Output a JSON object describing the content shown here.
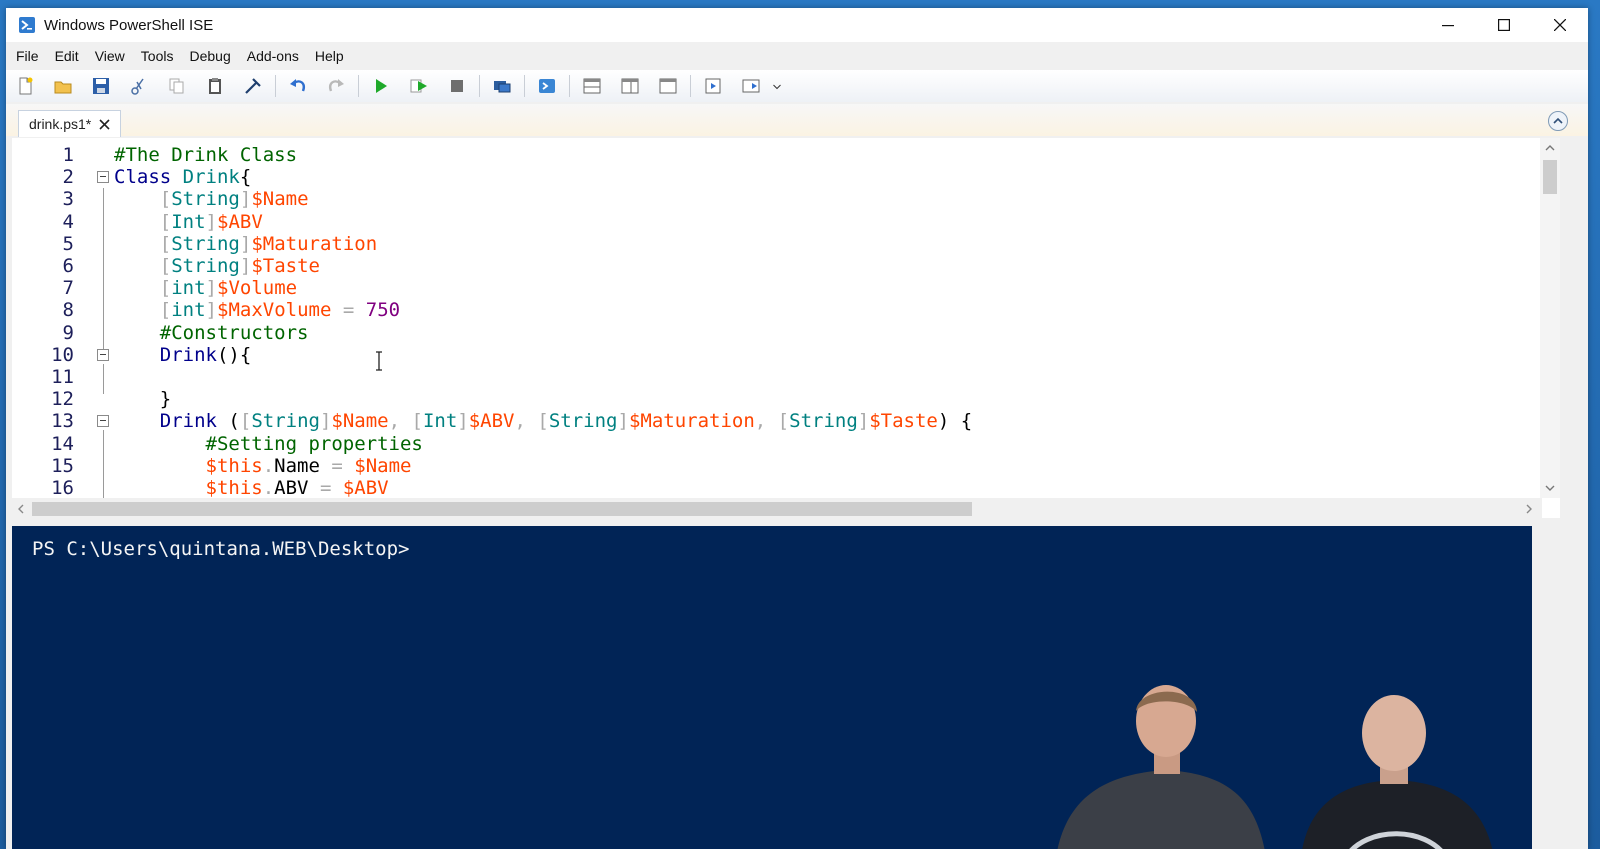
{
  "window": {
    "title": "Windows PowerShell ISE"
  },
  "menu": [
    "File",
    "Edit",
    "View",
    "Tools",
    "Debug",
    "Add-ons",
    "Help"
  ],
  "tab": {
    "label": "drink.ps1*"
  },
  "editor": {
    "lines": [
      {
        "n": "1",
        "fold": false,
        "tokens": [
          [
            "c",
            "#The Drink Class"
          ]
        ]
      },
      {
        "n": "2",
        "fold": true,
        "tokens": [
          [
            "k",
            "Class"
          ],
          [
            "d",
            " "
          ],
          [
            "t",
            "Drink"
          ],
          [
            "d",
            "{"
          ]
        ]
      },
      {
        "n": "3",
        "fold": false,
        "tokens": [
          [
            "d",
            "    "
          ],
          [
            "o",
            "["
          ],
          [
            "t",
            "String"
          ],
          [
            "o",
            "]"
          ],
          [
            "v",
            "$Name"
          ]
        ]
      },
      {
        "n": "4",
        "fold": false,
        "tokens": [
          [
            "d",
            "    "
          ],
          [
            "o",
            "["
          ],
          [
            "t",
            "Int"
          ],
          [
            "o",
            "]"
          ],
          [
            "v",
            "$ABV"
          ]
        ]
      },
      {
        "n": "5",
        "fold": false,
        "tokens": [
          [
            "d",
            "    "
          ],
          [
            "o",
            "["
          ],
          [
            "t",
            "String"
          ],
          [
            "o",
            "]"
          ],
          [
            "v",
            "$Maturation"
          ]
        ]
      },
      {
        "n": "6",
        "fold": false,
        "tokens": [
          [
            "d",
            "    "
          ],
          [
            "o",
            "["
          ],
          [
            "t",
            "String"
          ],
          [
            "o",
            "]"
          ],
          [
            "v",
            "$Taste"
          ]
        ]
      },
      {
        "n": "7",
        "fold": false,
        "tokens": [
          [
            "d",
            "    "
          ],
          [
            "o",
            "["
          ],
          [
            "t",
            "int"
          ],
          [
            "o",
            "]"
          ],
          [
            "v",
            "$Volume"
          ]
        ]
      },
      {
        "n": "8",
        "fold": false,
        "tokens": [
          [
            "d",
            "    "
          ],
          [
            "o",
            "["
          ],
          [
            "t",
            "int"
          ],
          [
            "o",
            "]"
          ],
          [
            "v",
            "$MaxVolume"
          ],
          [
            "d",
            " "
          ],
          [
            "o",
            "="
          ],
          [
            "d",
            " "
          ],
          [
            "n",
            "750"
          ]
        ]
      },
      {
        "n": "9",
        "fold": false,
        "tokens": [
          [
            "d",
            "    "
          ],
          [
            "c",
            "#Constructors"
          ]
        ]
      },
      {
        "n": "10",
        "fold": true,
        "tokens": [
          [
            "d",
            "    "
          ],
          [
            "k",
            "Drink"
          ],
          [
            "d",
            "(){"
          ]
        ]
      },
      {
        "n": "11",
        "fold": false,
        "tokens": [
          [
            "d",
            ""
          ]
        ]
      },
      {
        "n": "12",
        "fold": false,
        "tokens": [
          [
            "d",
            "    }"
          ]
        ]
      },
      {
        "n": "13",
        "fold": true,
        "tokens": [
          [
            "d",
            "    "
          ],
          [
            "k",
            "Drink"
          ],
          [
            "d",
            " ("
          ],
          [
            "o",
            "["
          ],
          [
            "t",
            "String"
          ],
          [
            "o",
            "]"
          ],
          [
            "v",
            "$Name"
          ],
          [
            "o",
            ", "
          ],
          [
            "o",
            "["
          ],
          [
            "t",
            "Int"
          ],
          [
            "o",
            "]"
          ],
          [
            "v",
            "$ABV"
          ],
          [
            "o",
            ", "
          ],
          [
            "o",
            "["
          ],
          [
            "t",
            "String"
          ],
          [
            "o",
            "]"
          ],
          [
            "v",
            "$Maturation"
          ],
          [
            "o",
            ", "
          ],
          [
            "o",
            "["
          ],
          [
            "t",
            "String"
          ],
          [
            "o",
            "]"
          ],
          [
            "v",
            "$Taste"
          ],
          [
            "d",
            ") {"
          ]
        ]
      },
      {
        "n": "14",
        "fold": false,
        "tokens": [
          [
            "d",
            "        "
          ],
          [
            "c",
            "#Setting properties"
          ]
        ]
      },
      {
        "n": "15",
        "fold": false,
        "tokens": [
          [
            "d",
            "        "
          ],
          [
            "v",
            "$this"
          ],
          [
            "o",
            "."
          ],
          [
            "d",
            "Name"
          ],
          [
            "d",
            " "
          ],
          [
            "o",
            "="
          ],
          [
            "d",
            " "
          ],
          [
            "v",
            "$Name"
          ]
        ]
      },
      {
        "n": "16",
        "fold": false,
        "tokens": [
          [
            "d",
            "        "
          ],
          [
            "v",
            "$this"
          ],
          [
            "o",
            "."
          ],
          [
            "d",
            "ABV"
          ],
          [
            "d",
            " "
          ],
          [
            "o",
            "="
          ],
          [
            "d",
            " "
          ],
          [
            "v",
            "$ABV"
          ]
        ]
      }
    ]
  },
  "console": {
    "prompt": "PS C:\\Users\\quintana.WEB\\Desktop>"
  },
  "colors": {
    "console_bg": "#012456",
    "editor_bg": "#ffffff"
  }
}
